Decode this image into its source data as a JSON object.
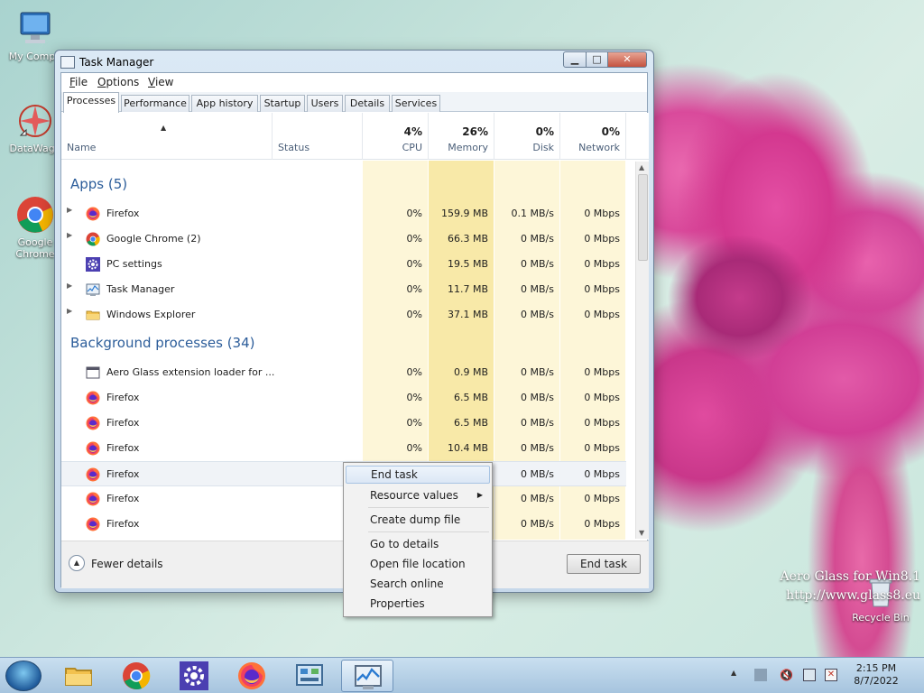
{
  "desktop": {
    "icons": [
      {
        "label": "My Compu"
      },
      {
        "label": "DataWago"
      },
      {
        "label": "Google Chrome"
      }
    ],
    "recycle_bin": "Recycle Bin",
    "watermark": [
      "Aero Glass for Win8.1",
      "http://www.glass8.eu"
    ]
  },
  "window": {
    "title": "Task Manager",
    "menu": [
      "File",
      "Options",
      "View"
    ],
    "tabs": [
      "Processes",
      "Performance",
      "App history",
      "Startup",
      "Users",
      "Details",
      "Services"
    ],
    "active_tab": "Processes",
    "columns": {
      "name": "Name",
      "status": "Status",
      "cpu": {
        "pct": "4%",
        "label": "CPU"
      },
      "memory": {
        "pct": "26%",
        "label": "Memory"
      },
      "disk": {
        "pct": "0%",
        "label": "Disk"
      },
      "network": {
        "pct": "0%",
        "label": "Network"
      }
    },
    "groups": [
      {
        "title": "Apps (5)",
        "rows": [
          {
            "name": "Firefox",
            "cpu": "0%",
            "mem": "159.9 MB",
            "disk": "0.1 MB/s",
            "net": "0 Mbps",
            "icon": "firefox-icon",
            "expandable": true
          },
          {
            "name": "Google Chrome (2)",
            "cpu": "0%",
            "mem": "66.3 MB",
            "disk": "0 MB/s",
            "net": "0 Mbps",
            "icon": "chrome-icon",
            "expandable": true
          },
          {
            "name": "PC settings",
            "cpu": "0%",
            "mem": "19.5 MB",
            "disk": "0 MB/s",
            "net": "0 Mbps",
            "icon": "gear-icon",
            "expandable": false
          },
          {
            "name": "Task Manager",
            "cpu": "0%",
            "mem": "11.7 MB",
            "disk": "0 MB/s",
            "net": "0 Mbps",
            "icon": "task-manager-icon",
            "expandable": true
          },
          {
            "name": "Windows Explorer",
            "cpu": "0%",
            "mem": "37.1 MB",
            "disk": "0 MB/s",
            "net": "0 Mbps",
            "icon": "folder-icon",
            "expandable": true
          }
        ]
      },
      {
        "title": "Background processes (34)",
        "rows": [
          {
            "name": "Aero Glass extension loader for ...",
            "cpu": "0%",
            "mem": "0.9 MB",
            "disk": "0 MB/s",
            "net": "0 Mbps",
            "icon": "window-icon"
          },
          {
            "name": "Firefox",
            "cpu": "0%",
            "mem": "6.5 MB",
            "disk": "0 MB/s",
            "net": "0 Mbps",
            "icon": "firefox-icon"
          },
          {
            "name": "Firefox",
            "cpu": "0%",
            "mem": "6.5 MB",
            "disk": "0 MB/s",
            "net": "0 Mbps",
            "icon": "firefox-icon"
          },
          {
            "name": "Firefox",
            "cpu": "0%",
            "mem": "10.4 MB",
            "disk": "0 MB/s",
            "net": "0 Mbps",
            "icon": "firefox-icon"
          },
          {
            "name": "Firefox",
            "cpu": "",
            "mem": "",
            "disk": "0 MB/s",
            "net": "0 Mbps",
            "icon": "firefox-icon",
            "highlighted": true
          },
          {
            "name": "Firefox",
            "cpu": "",
            "mem": "",
            "disk": "0 MB/s",
            "net": "0 Mbps",
            "icon": "firefox-icon"
          },
          {
            "name": "Firefox",
            "cpu": "",
            "mem": "",
            "disk": "0 MB/s",
            "net": "0 Mbps",
            "icon": "firefox-icon"
          },
          {
            "name": "Firefox",
            "cpu": "",
            "mem": "",
            "disk": "0 MB/s",
            "net": "",
            "icon": "firefox-icon"
          }
        ]
      }
    ],
    "footer": {
      "fewer_details": "Fewer details",
      "end_task": "End task"
    }
  },
  "context_menu": {
    "items": [
      "End task",
      "Resource values",
      "Create dump file",
      "Go to details",
      "Open file location",
      "Search online",
      "Properties"
    ],
    "selected": "End task"
  },
  "taskbar": {
    "pinned": [
      "folder-icon",
      "chrome-icon",
      "gear-icon",
      "firefox-icon",
      "control-panel-icon",
      "task-manager-icon"
    ],
    "active": "task-manager-icon",
    "clock": {
      "time": "2:15 PM",
      "date": "8/7/2022"
    }
  },
  "colors": {
    "accent_text": "#2c5d9a",
    "heat_light": "#fdf6d8",
    "heat_medium": "#f8e9a8",
    "selection": "#dce7f5"
  }
}
